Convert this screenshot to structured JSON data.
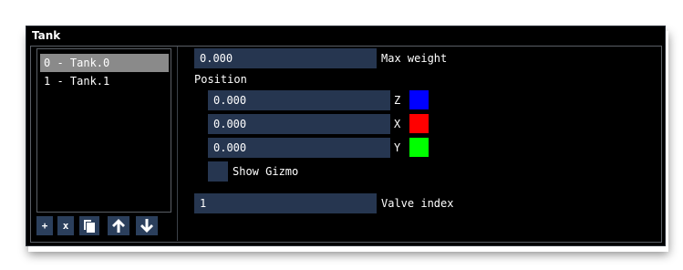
{
  "window": {
    "title": "Tank"
  },
  "tank_list": {
    "items": [
      {
        "label": "0 - Tank.0",
        "selected": true
      },
      {
        "label": "1 - Tank.1",
        "selected": false
      }
    ]
  },
  "toolbar": {
    "add_label": "+",
    "remove_label": "x",
    "buttons": [
      "add",
      "remove",
      "copy",
      "move-up",
      "move-down"
    ]
  },
  "properties": {
    "max_weight": {
      "value": "0.000",
      "label": "Max weight"
    },
    "position": {
      "label": "Position",
      "z": {
        "value": "0.000",
        "axis": "Z",
        "color": "#0000ff"
      },
      "x": {
        "value": "0.000",
        "axis": "X",
        "color": "#ff0000"
      },
      "y": {
        "value": "0.000",
        "axis": "Y",
        "color": "#00ff00"
      }
    },
    "show_gizmo": {
      "label": "Show Gizmo",
      "checked": false
    },
    "valve_index": {
      "value": "1",
      "label": "Valve index"
    }
  },
  "colors": {
    "background": "#000000",
    "field": "#263650",
    "button": "#2b3f5c",
    "selected_item": "#8a8a8a"
  }
}
